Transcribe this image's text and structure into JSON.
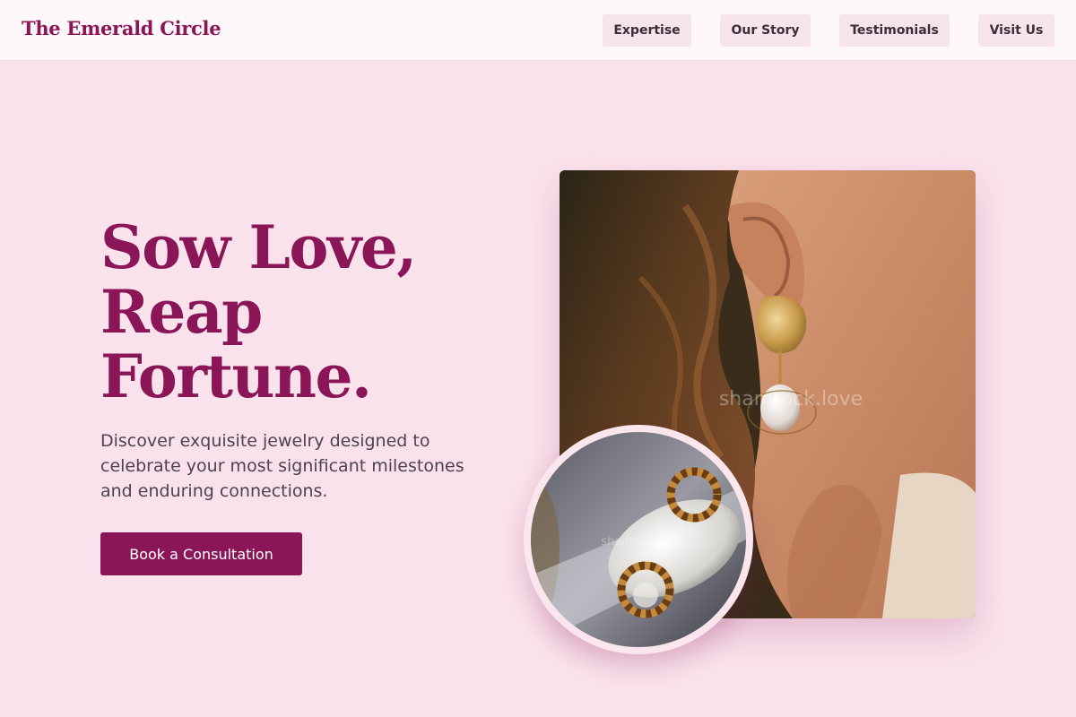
{
  "header": {
    "brand": "The Emerald Circle",
    "nav": [
      "Expertise",
      "Our Story",
      "Testimonials",
      "Visit Us"
    ]
  },
  "hero": {
    "headline_lines": [
      "Sow Love,",
      "Reap",
      "Fortune."
    ],
    "subtext": "Discover exquisite jewelry designed to celebrate your most significant milestones and enduring connections.",
    "cta_label": "Book a Consultation"
  },
  "images": {
    "main": {
      "description": "close-up of woman's ear wearing gold hammered earring with pearl drop",
      "watermark": "shamrock.love"
    },
    "inset": {
      "description": "pair of gold twisted hoop earrings on white stone",
      "watermark": "shamrock"
    }
  },
  "colors": {
    "accent": "#8a1657",
    "background": "#fae2ec",
    "header_bg": "#fff8fa",
    "nav_button_bg": "#f7e4ec"
  }
}
